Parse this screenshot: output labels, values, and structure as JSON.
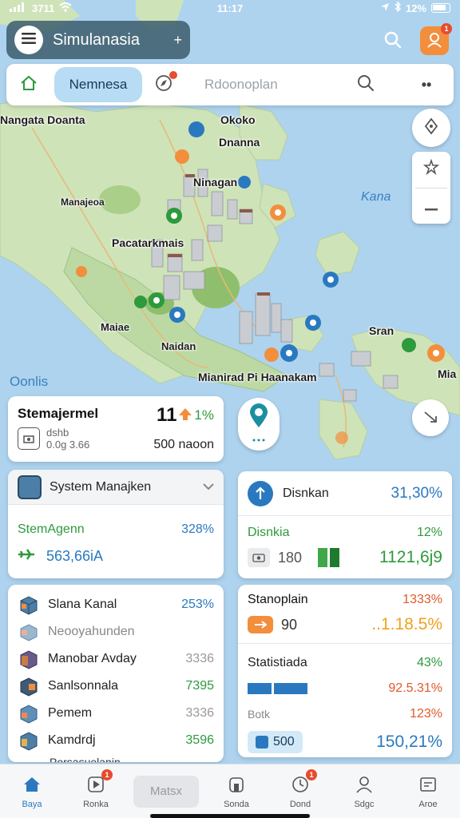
{
  "status_bar": {
    "left": "3711",
    "time": "11:17",
    "battery": "12%"
  },
  "app_bar": {
    "title": "Simulanasia",
    "title_suffix": "+",
    "avatar_badge": "1"
  },
  "tab_strip": {
    "active_tab": "Nemnesa",
    "placeholder": "Rdoonoplan",
    "more": "••"
  },
  "map": {
    "labels": [
      {
        "text": "Nangata Doanta",
        "kind": "place"
      },
      {
        "text": "Okoko",
        "kind": "place"
      },
      {
        "text": "Dnanna",
        "kind": "place"
      },
      {
        "text": "Ninagan",
        "kind": "place"
      },
      {
        "text": "Kana",
        "kind": "sea"
      },
      {
        "text": "Manajeoa",
        "kind": "place"
      },
      {
        "text": "Pacatarkmais",
        "kind": "place"
      },
      {
        "text": "Maiae",
        "kind": "place"
      },
      {
        "text": "Naidan",
        "kind": "place"
      },
      {
        "text": "Sran",
        "kind": "place"
      },
      {
        "text": "Mianirad Pi Haanakam",
        "kind": "place"
      },
      {
        "text": "Mia",
        "kind": "place"
      },
      {
        "text": "Oonlis",
        "kind": "region"
      }
    ]
  },
  "stat_card": {
    "title": "Stemajermel",
    "value": "11",
    "change": "1%",
    "sub_line1": "dshb",
    "sub_line2": "0.0g 3.66",
    "right": "500 naoon"
  },
  "system_card": {
    "title": "System Manajken",
    "row1_label": "StemAgenn",
    "row1_value": "328%",
    "row2_value": "563,66iA"
  },
  "dispatch_card": {
    "title": "Disnkan",
    "value": "31,30%",
    "row1_label": "Disnkia",
    "row1_value": "12%",
    "row2_num": "180",
    "row2_big": "1121,6j9"
  },
  "list_card": {
    "items": [
      {
        "name": "Slana Kanal",
        "value": "253%",
        "tone": "blue",
        "muted": false
      },
      {
        "name": "Neooyahunden",
        "value": "",
        "tone": "gray",
        "muted": true
      },
      {
        "name": "Manobar Avday",
        "value": "3336",
        "tone": "gray",
        "muted": false
      },
      {
        "name": "Sanlsonnala",
        "value": "7395",
        "tone": "green",
        "muted": false
      },
      {
        "name": "Pemem",
        "value": "3336",
        "tone": "gray",
        "muted": false
      },
      {
        "name": "Kamdrdj",
        "value": "3596",
        "tone": "green",
        "muted": false
      }
    ],
    "footer": "Porsasuelanin"
  },
  "stats2_card": {
    "top_title": "Stanoplain",
    "top_pct": "1333%",
    "top_num": "90",
    "top_big": "..1.18.5%",
    "rows": [
      {
        "label": "Statistiada",
        "value": "43%",
        "tone": "green"
      },
      {
        "label": "",
        "value": "92.5.31%",
        "tone": "orange"
      },
      {
        "label": "Botk",
        "value": "123%",
        "tone": "orange"
      }
    ],
    "box_label": "500",
    "box_value": "150,21%"
  },
  "bottom_nav": [
    {
      "label": "Baya",
      "icon": "home-icon",
      "active": true,
      "badge": ""
    },
    {
      "label": "Ronka",
      "icon": "play-icon",
      "active": false,
      "badge": "1"
    },
    {
      "label": "Matsx",
      "icon": "pill",
      "active": false,
      "badge": ""
    },
    {
      "label": "Sonda",
      "icon": "building-icon",
      "active": false,
      "badge": ""
    },
    {
      "label": "Dond",
      "icon": "clock-icon",
      "active": false,
      "badge": "1"
    },
    {
      "label": "Sdgc",
      "icon": "user-icon",
      "active": false,
      "badge": ""
    },
    {
      "label": "Aroe",
      "icon": "box-icon",
      "active": false,
      "badge": ""
    }
  ],
  "colors": {
    "accent": "#2a79c0",
    "green": "#2d9a3c",
    "orange": "#f38e3c",
    "sea": "#aed3ee",
    "land": "#cfe3b9"
  }
}
